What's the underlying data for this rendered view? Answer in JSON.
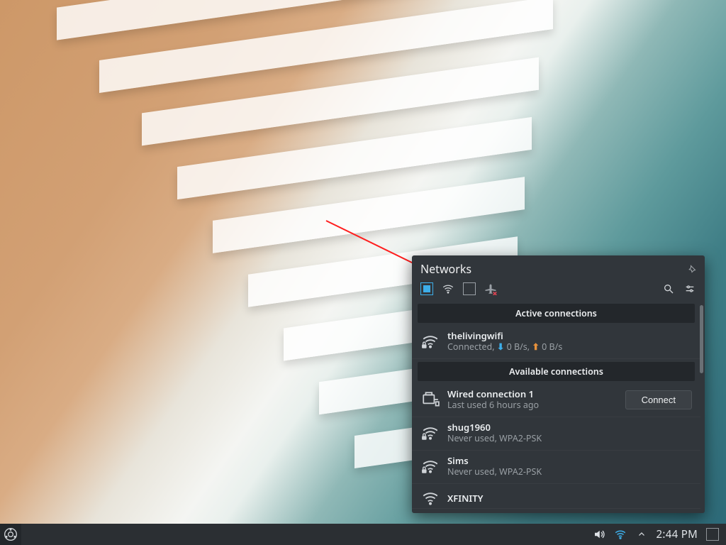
{
  "applet": {
    "title": "Networks",
    "sections": {
      "active": "Active connections",
      "available": "Available connections"
    },
    "active_conn": {
      "name": "thelivingwifi",
      "status_prefix": "Connected, ",
      "down_rate": "0 B/s",
      "up_rate": "0 B/s"
    },
    "available": [
      {
        "name": "Wired connection 1",
        "sub": "Last used 6 hours ago",
        "type": "wired",
        "has_connect": true
      },
      {
        "name": "shug1960",
        "sub": "Never used, WPA2-PSK",
        "type": "wifi-lock"
      },
      {
        "name": "Sims",
        "sub": "Never used, WPA2-PSK",
        "type": "wifi-lock"
      },
      {
        "name": "XFINITY",
        "sub": "",
        "type": "wifi"
      }
    ],
    "connect_label": "Connect"
  },
  "taskbar": {
    "clock": "2:44 PM"
  },
  "icons": {
    "pin": "pin-icon",
    "wifi": "wifi-icon",
    "ethernet": "ethernet-icon",
    "airplane": "airplane-icon",
    "search": "search-icon",
    "settings_sliders": "settings-icon",
    "volume": "volume-icon",
    "chevron_up": "chevron-up-icon",
    "kubuntu": "kubuntu-icon",
    "lock": "lock-icon"
  }
}
